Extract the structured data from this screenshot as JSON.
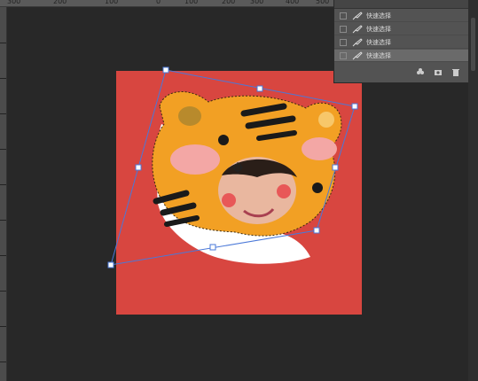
{
  "ruler_top": {
    "ticks": [
      "300",
      "200",
      "100",
      "0",
      "100",
      "200",
      "300",
      "400",
      "500",
      "600"
    ]
  },
  "layers": {
    "items": [
      {
        "name": "快速选择",
        "selected": false
      },
      {
        "name": "快速选择",
        "selected": false
      },
      {
        "name": "快速选择",
        "selected": false
      },
      {
        "name": "快速选择",
        "selected": true
      }
    ]
  },
  "canvas": {
    "background_color": "#d84640",
    "tiger_color": "#f2a024",
    "selection_color": "#4a78d8"
  },
  "icons": {
    "footer": [
      "new-group-icon",
      "camera-icon",
      "trash-icon"
    ]
  }
}
